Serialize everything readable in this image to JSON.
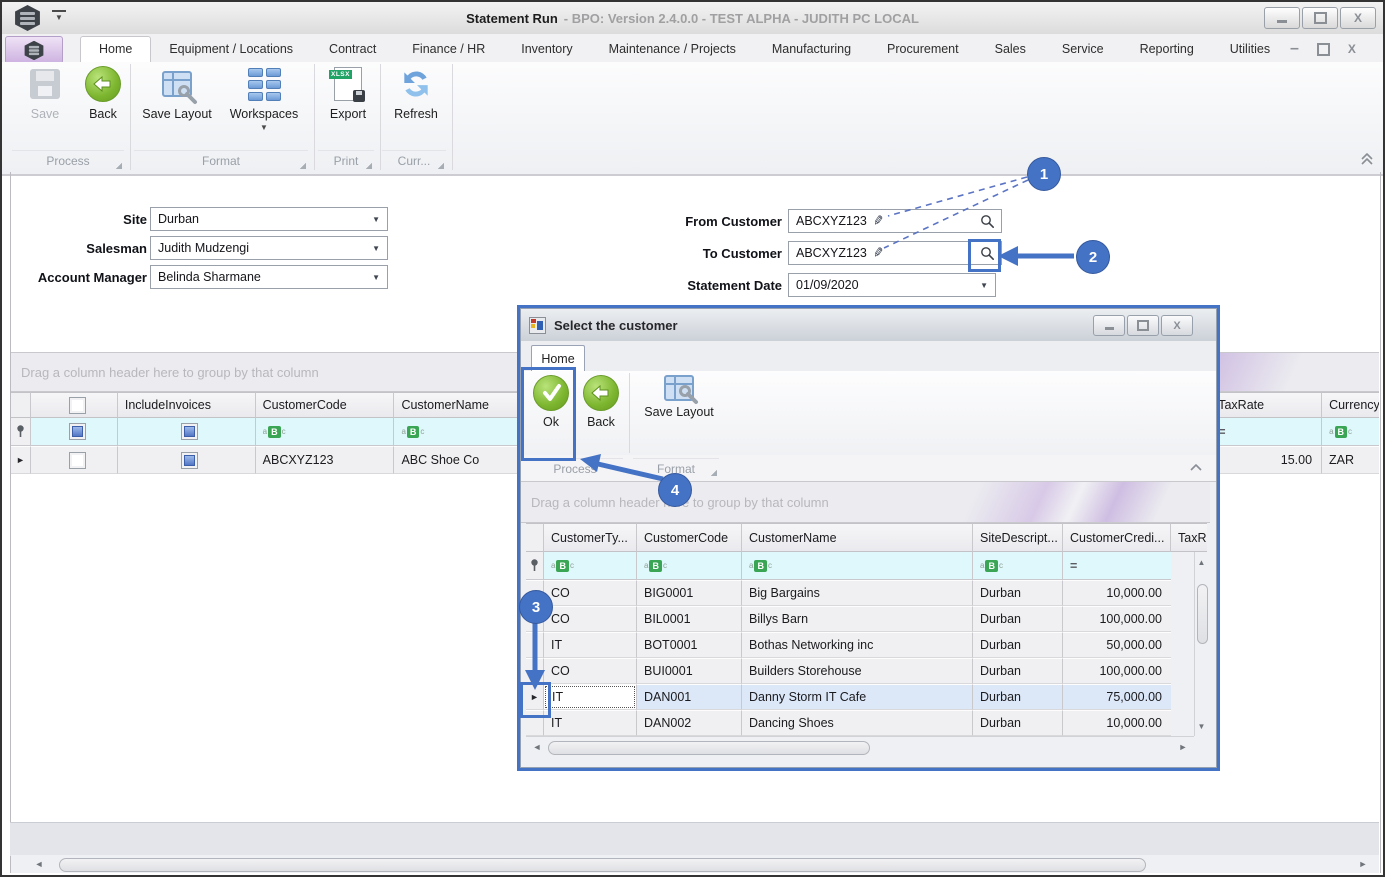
{
  "titlebar": {
    "title": "Statement Run",
    "subtitle": "- BPO: Version 2.4.0.0 - TEST ALPHA - JUDITH PC LOCAL"
  },
  "ribbon": {
    "tabs": [
      "Home",
      "Equipment / Locations",
      "Contract",
      "Finance / HR",
      "Inventory",
      "Maintenance / Projects",
      "Manufacturing",
      "Procurement",
      "Sales",
      "Service",
      "Reporting",
      "Utilities"
    ]
  },
  "toolbar": {
    "save": "Save",
    "back": "Back",
    "save_layout": "Save Layout",
    "workspaces": "Workspaces",
    "export": "Export",
    "refresh": "Refresh",
    "group_process": "Process",
    "group_format": "Format",
    "group_print": "Print",
    "group_curr": "Curr...",
    "xlsx_badge": "XLSX"
  },
  "form": {
    "site_label": "Site",
    "site_value": "Durban",
    "salesman_label": "Salesman",
    "salesman_value": "Judith Mudzengi",
    "account_manager_label": "Account Manager",
    "account_manager_value": "Belinda Sharmane",
    "from_customer_label": "From Customer",
    "from_customer_value": "ABCXYZ123",
    "to_customer_label": "To Customer",
    "to_customer_value": "ABCXYZ123",
    "statement_date_label": "Statement Date",
    "statement_date_value": "01/09/2020"
  },
  "main_grid": {
    "group_hint": "Drag a column header here to group by that column",
    "col_include_invoices": "IncludeInvoices",
    "col_customer_code": "CustomerCode",
    "col_customer_name": "CustomerName",
    "col_tax_rate": "TaxRate",
    "col_currency": "Currency",
    "row_customer_code": "ABCXYZ123",
    "row_customer_name": "ABC Shoe Co",
    "row_tax_rate": "15.00",
    "row_currency": "ZAR"
  },
  "dialog": {
    "title": "Select the customer",
    "tab_home": "Home",
    "ok": "Ok",
    "back": "Back",
    "save_layout": "Save Layout",
    "group_process": "Process",
    "group_format": "Format",
    "group_hint": "Drag a column header here to group by that column",
    "col_type": "CustomerTy...",
    "col_code": "CustomerCode",
    "col_name": "CustomerName",
    "col_site": "SiteDescript...",
    "col_credit": "CustomerCredi...",
    "col_tax": "TaxRa",
    "rows": [
      {
        "type": "CO",
        "code": "BIG0001",
        "name": "Big Bargains",
        "site": "Durban",
        "credit": "10,000.00"
      },
      {
        "type": "CO",
        "code": "BIL0001",
        "name": "Billys Barn",
        "site": "Durban",
        "credit": "100,000.00"
      },
      {
        "type": "IT",
        "code": "BOT0001",
        "name": "Bothas Networking inc",
        "site": "Durban",
        "credit": "50,000.00"
      },
      {
        "type": "CO",
        "code": "BUI0001",
        "name": "Builders Storehouse",
        "site": "Durban",
        "credit": "100,000.00"
      },
      {
        "type": "IT",
        "code": "DAN001",
        "name": "Danny Storm IT Cafe",
        "site": "Durban",
        "credit": "75,000.00"
      },
      {
        "type": "IT",
        "code": "DAN002",
        "name": "Dancing Shoes",
        "site": "Durban",
        "credit": "10,000.00"
      }
    ]
  },
  "callouts": {
    "n1": "1",
    "n2": "2",
    "n3": "3",
    "n4": "4"
  },
  "icons": {
    "dropdown": "▼",
    "pencil": "✎",
    "abc_a": "a",
    "abc_b": "B",
    "abc_c": "c",
    "eq": "=",
    "row_pointer": "►",
    "left": "◄",
    "right": "►",
    "up": "▲",
    "down": "▼",
    "minimize": "–",
    "close": "X"
  },
  "colors": {
    "accent_blue": "#4472c4",
    "filter_row_bg": "#def8fb",
    "selected_row_bg": "#dce8f8"
  }
}
